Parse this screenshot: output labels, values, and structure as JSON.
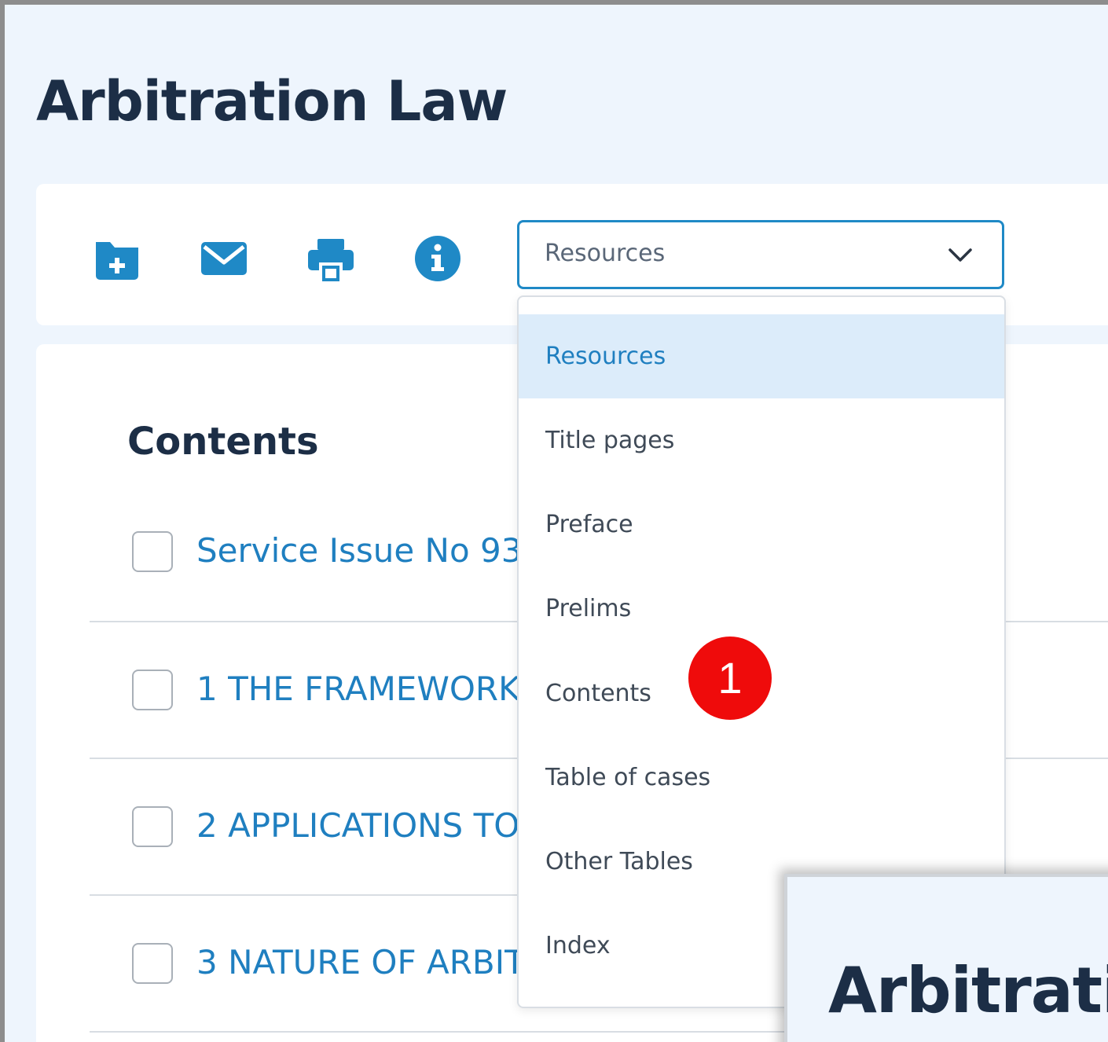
{
  "page": {
    "title": "Arbitration Law"
  },
  "toolbar": {
    "icons": [
      "folder-plus-icon",
      "envelope-icon",
      "printer-icon",
      "info-icon"
    ],
    "select": {
      "value": "Resources"
    }
  },
  "contents": {
    "heading": "Contents",
    "items": [
      {
        "label": "Service Issue No 93"
      },
      {
        "label": "1 THE FRAMEWORK"
      },
      {
        "label": "2 APPLICATIONS TO"
      },
      {
        "label": "3 NATURE OF ARBIT"
      }
    ]
  },
  "dropdown": {
    "options": [
      {
        "label": "Resources",
        "selected": true
      },
      {
        "label": "Title pages"
      },
      {
        "label": "Preface"
      },
      {
        "label": "Prelims"
      },
      {
        "label": "Contents"
      },
      {
        "label": "Table of cases"
      },
      {
        "label": "Other Tables"
      },
      {
        "label": "Index"
      }
    ]
  },
  "annotation": {
    "step": "1"
  },
  "inset": {
    "title": "Arbitrati"
  },
  "colors": {
    "accent": "#1f89c6",
    "link": "#1f7fc0",
    "heading": "#1c2e46",
    "badge": "#ef0b0b",
    "selected_bg": "#dcecfa"
  }
}
